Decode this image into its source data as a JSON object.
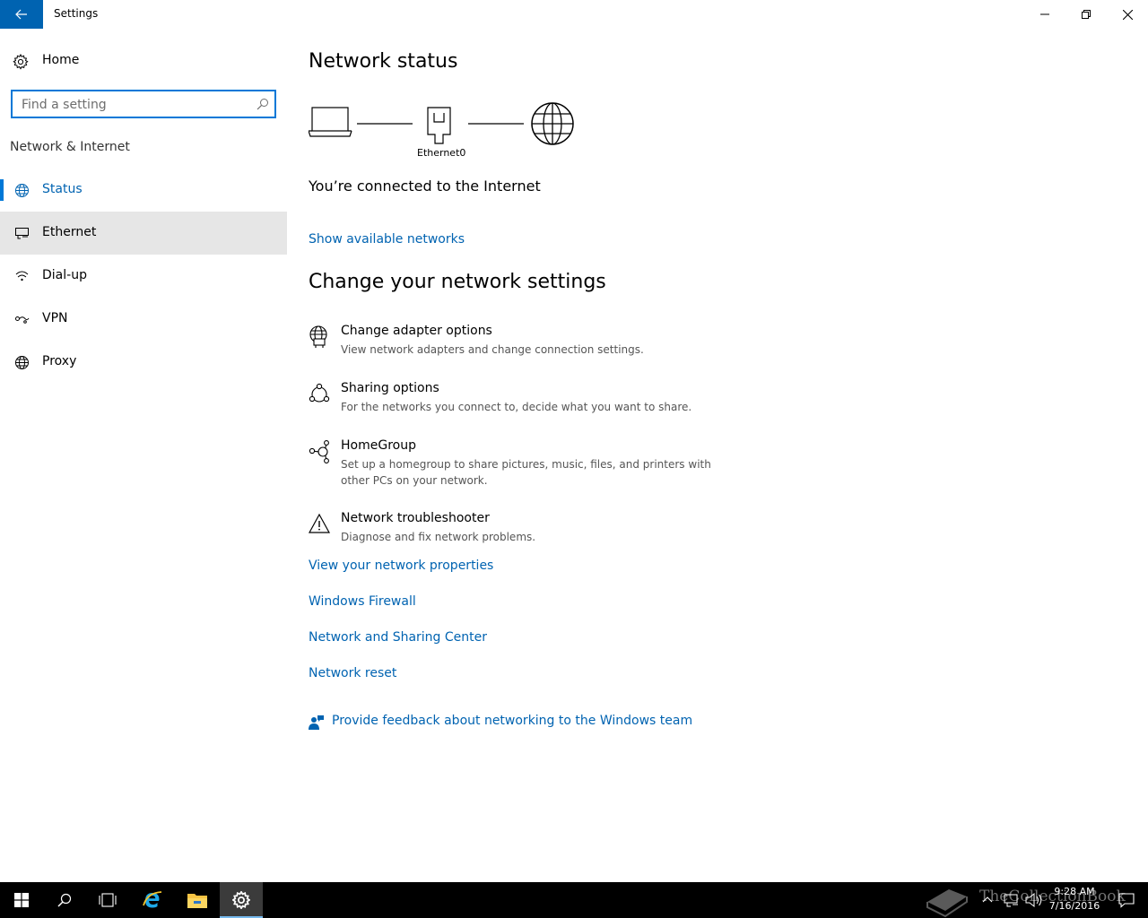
{
  "window": {
    "title": "Settings"
  },
  "sidebar": {
    "home_label": "Home",
    "search_placeholder": "Find a setting",
    "section_label": "Network & Internet",
    "items": [
      {
        "label": "Status",
        "icon": "globe-status-icon",
        "selected": true
      },
      {
        "label": "Ethernet",
        "icon": "ethernet-icon",
        "hover": true
      },
      {
        "label": "Dial-up",
        "icon": "dialup-icon"
      },
      {
        "label": "VPN",
        "icon": "vpn-icon"
      },
      {
        "label": "Proxy",
        "icon": "globe-icon"
      }
    ]
  },
  "main": {
    "heading": "Network status",
    "adapter_label": "Ethernet0",
    "connection_status": "You’re connected to the Internet",
    "show_networks_link": "Show available networks",
    "settings_heading": "Change your network settings",
    "options": [
      {
        "title": "Change adapter options",
        "desc": "View network adapters and change connection settings.",
        "icon": "adapter-icon"
      },
      {
        "title": "Sharing options",
        "desc": "For the networks you connect to, decide what you want to share.",
        "icon": "sharing-icon"
      },
      {
        "title": "HomeGroup",
        "desc": "Set up a homegroup to share pictures, music, files, and printers with other PCs on your network.",
        "icon": "homegroup-icon"
      },
      {
        "title": "Network troubleshooter",
        "desc": "Diagnose and fix network problems.",
        "icon": "warning-icon"
      }
    ],
    "links": [
      "View your network properties",
      "Windows Firewall",
      "Network and Sharing Center",
      "Network reset"
    ],
    "feedback_link": "Provide feedback about networking to the Windows team"
  },
  "taskbar": {
    "time": "9:28 AM",
    "date": "7/16/2016",
    "watermark": "TheCollectionBook"
  },
  "colors": {
    "accent": "#0078d7",
    "link": "#0063b1",
    "taskbar": "#000000"
  }
}
